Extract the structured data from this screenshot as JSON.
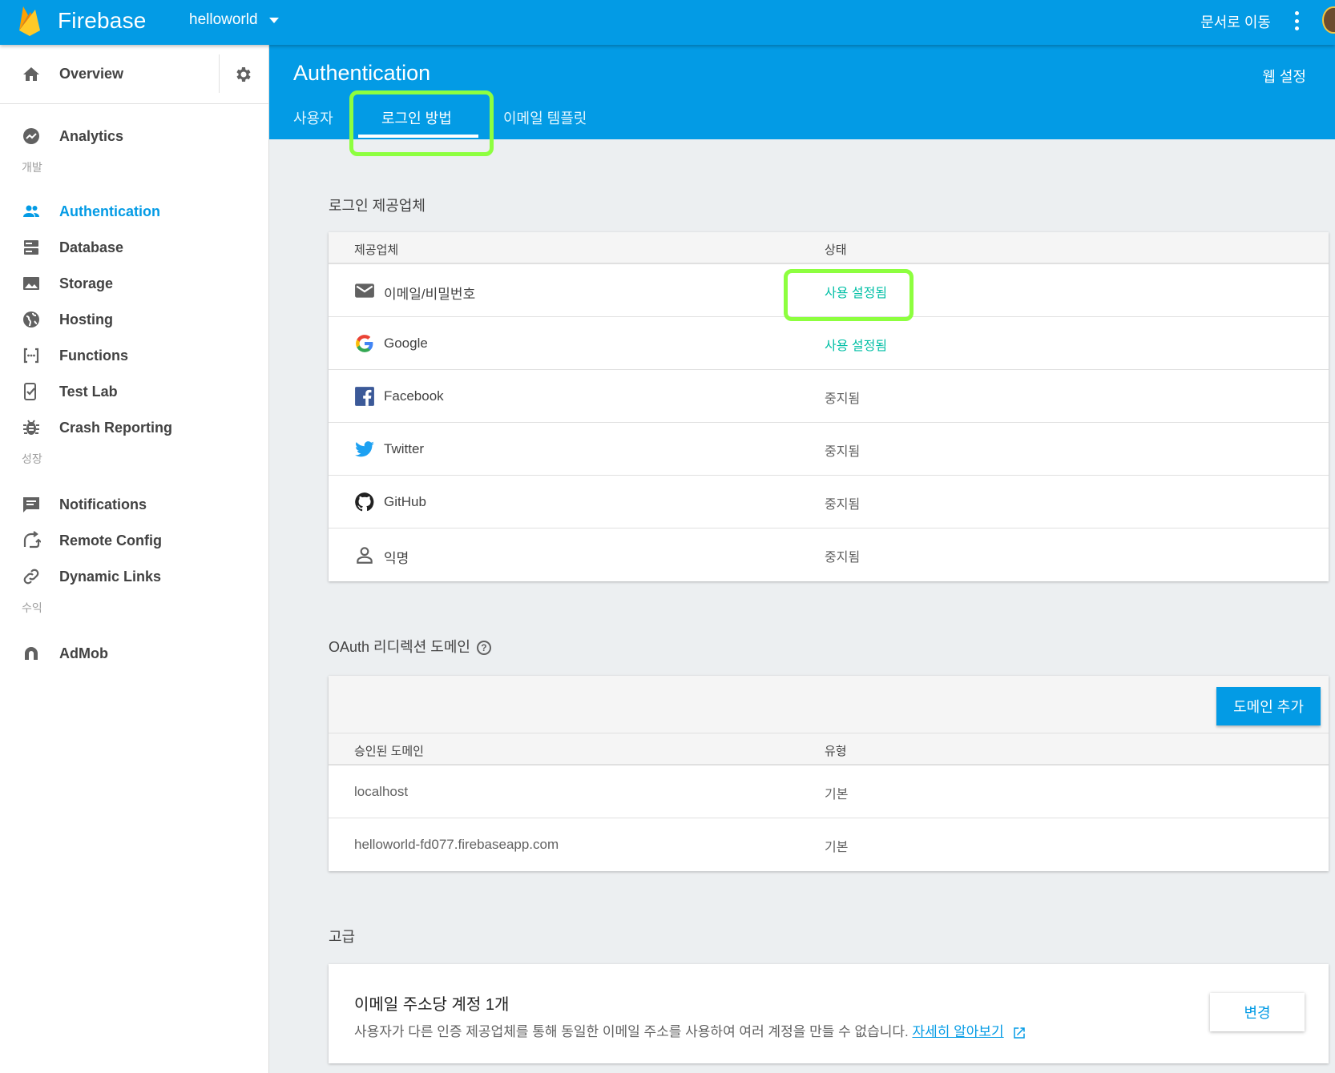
{
  "topbar": {
    "brand": "Firebase",
    "project": "helloworld",
    "docs_link": "문서로 이동"
  },
  "sidebar": {
    "overview": "Overview",
    "analytics": "Analytics",
    "section_develop": "개발",
    "develop_items": [
      {
        "label": "Authentication",
        "icon": "people-icon"
      },
      {
        "label": "Database",
        "icon": "database-icon"
      },
      {
        "label": "Storage",
        "icon": "image-icon"
      },
      {
        "label": "Hosting",
        "icon": "globe-icon"
      },
      {
        "label": "Functions",
        "icon": "functions-icon"
      },
      {
        "label": "Test Lab",
        "icon": "test-lab-icon"
      },
      {
        "label": "Crash Reporting",
        "icon": "bug-icon"
      }
    ],
    "section_grow": "성장",
    "grow_items": [
      {
        "label": "Notifications",
        "icon": "message-icon"
      },
      {
        "label": "Remote Config",
        "icon": "remote-config-icon"
      },
      {
        "label": "Dynamic Links",
        "icon": "link-icon"
      }
    ],
    "section_earn": "수익",
    "earn_items": [
      {
        "label": "AdMob",
        "icon": "admob-icon"
      }
    ],
    "active": "Authentication"
  },
  "header": {
    "title": "Authentication",
    "web_setup": "웹 설정",
    "tabs": [
      "사용자",
      "로그인 방법",
      "이메일 템플릿"
    ],
    "active_tab": "로그인 방법"
  },
  "providers": {
    "section_title": "로그인 제공업체",
    "col_provider": "제공업체",
    "col_status": "상태",
    "rows": [
      {
        "name": "이메일/비밀번호",
        "status": "사용 설정됨",
        "icon": "email-icon"
      },
      {
        "name": "Google",
        "status": "사용 설정됨",
        "icon": "google-icon"
      },
      {
        "name": "Facebook",
        "status": "중지됨",
        "icon": "facebook-icon"
      },
      {
        "name": "Twitter",
        "status": "중지됨",
        "icon": "twitter-icon"
      },
      {
        "name": "GitHub",
        "status": "중지됨",
        "icon": "github-icon"
      },
      {
        "name": "익명",
        "status": "중지됨",
        "icon": "person-icon"
      }
    ]
  },
  "oauth": {
    "section_title": "OAuth 리디렉션 도메인",
    "add_button": "도메인 추가",
    "col_domain": "승인된 도메인",
    "col_type": "유형",
    "rows": [
      {
        "domain": "localhost",
        "type": "기본"
      },
      {
        "domain": "helloworld-fd077.firebaseapp.com",
        "type": "기본"
      }
    ]
  },
  "advanced": {
    "section_title": "고급",
    "title": "이메일 주소당 계정 1개",
    "description": "사용자가 다른 인증 제공업체를 통해 동일한 이메일 주소를 사용하여 여러 계정을 만들 수 없습니다.",
    "learn_more": "자세히 알아보기",
    "change_button": "변경"
  },
  "colors": {
    "primary": "#039be5",
    "enabled": "#00bfa5",
    "highlight": "#8dff3f"
  }
}
